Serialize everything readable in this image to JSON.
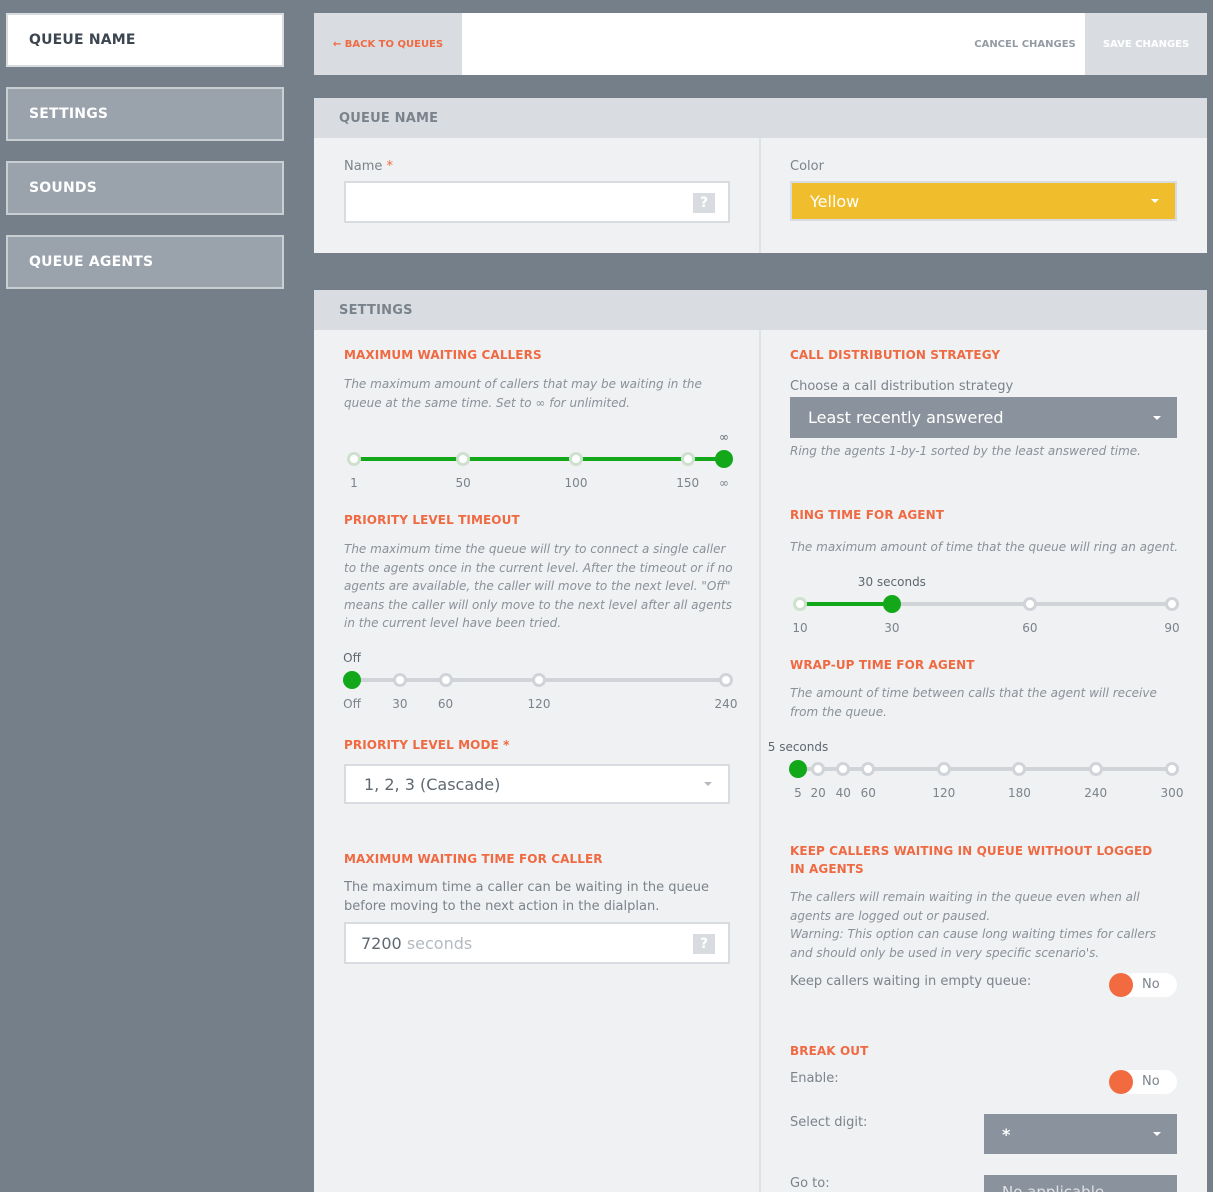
{
  "sidebar": {
    "items": [
      {
        "label": "QUEUE NAME"
      },
      {
        "label": "SETTINGS"
      },
      {
        "label": "SOUNDS"
      },
      {
        "label": "QUEUE AGENTS"
      }
    ]
  },
  "toolbar": {
    "back_label": "← BACK TO QUEUES",
    "cancel_label": "CANCEL CHANGES",
    "save_label": "SAVE CHANGES"
  },
  "queue_name_panel": {
    "title": "QUEUE NAME",
    "name_label": "Name",
    "required_mark": "*",
    "name_value": "",
    "help_icon": "?",
    "color_label": "Color",
    "color_value": "Yellow",
    "color_hex": "#f0bd2d"
  },
  "settings_panel": {
    "title": "SETTINGS",
    "max_waiting_callers": {
      "title": "MAXIMUM WAITING CALLERS",
      "description": "The maximum amount of callers that may be waiting in the queue at the same time. Set to ∞ for unlimited.",
      "ticks": [
        "1",
        "50",
        "100",
        "150",
        "∞"
      ],
      "value_label": "∞",
      "selected_index": 4
    },
    "priority_level_timeout": {
      "title": "PRIORITY LEVEL TIMEOUT",
      "description": "The maximum time the queue will try to connect a single caller to the agents once in the current level. After the timeout or if no agents are available, the caller will move to the next level. \"Off\" means the caller will only move to the next level after all agents in the current level have been tried.",
      "ticks": [
        "Off",
        "30",
        "60",
        "120",
        "240"
      ],
      "value_label": "Off",
      "selected_index": 0
    },
    "priority_level_mode": {
      "title": "PRIORITY LEVEL MODE",
      "required_mark": "*",
      "value": "1, 2, 3 (Cascade)"
    },
    "max_waiting_time": {
      "title": "MAXIMUM WAITING TIME FOR CALLER",
      "description": "The maximum time a caller can be waiting in the queue before moving to the next action in the dialplan.",
      "value": "7200",
      "unit": "seconds",
      "help_icon": "?"
    },
    "call_distribution": {
      "title": "CALL DISTRIBUTION STRATEGY",
      "label": "Choose a call distribution strategy",
      "value": "Least recently answered",
      "hint": "Ring the agents 1-by-1 sorted by the least answered time."
    },
    "ring_time": {
      "title": "RING TIME FOR AGENT",
      "description": "The maximum amount of time that the queue will ring an agent.",
      "ticks": [
        "10",
        "30",
        "60",
        "90"
      ],
      "value_label": "30 seconds",
      "selected_index": 1
    },
    "wrap_up_time": {
      "title": "WRAP-UP TIME FOR AGENT",
      "description": "The amount of time between calls that the agent will receive from the queue.",
      "ticks": [
        "5",
        "20",
        "40",
        "60",
        "120",
        "180",
        "240",
        "300"
      ],
      "value_label": "5 seconds",
      "selected_index": 0
    },
    "keep_callers": {
      "title": "KEEP CALLERS WAITING IN QUEUE WITHOUT LOGGED IN AGENTS",
      "description": "The callers will remain waiting in the queue even when all agents are logged out or paused.",
      "warning": "Warning: This option can cause long waiting times for callers and should only be used in very specific scenario's.",
      "toggle_label": "Keep callers waiting in empty queue:",
      "toggle_value": "No"
    },
    "break_out": {
      "title": "BREAK OUT",
      "enable_label": "Enable:",
      "enable_value": "No",
      "digit_label": "Select digit:",
      "digit_value": "*",
      "goto_label": "Go to:",
      "goto_value": "No applicable"
    }
  },
  "colors": {
    "accent": "#ef6a42",
    "slider_green": "#12a81a",
    "select_gray": "#8a939d"
  }
}
